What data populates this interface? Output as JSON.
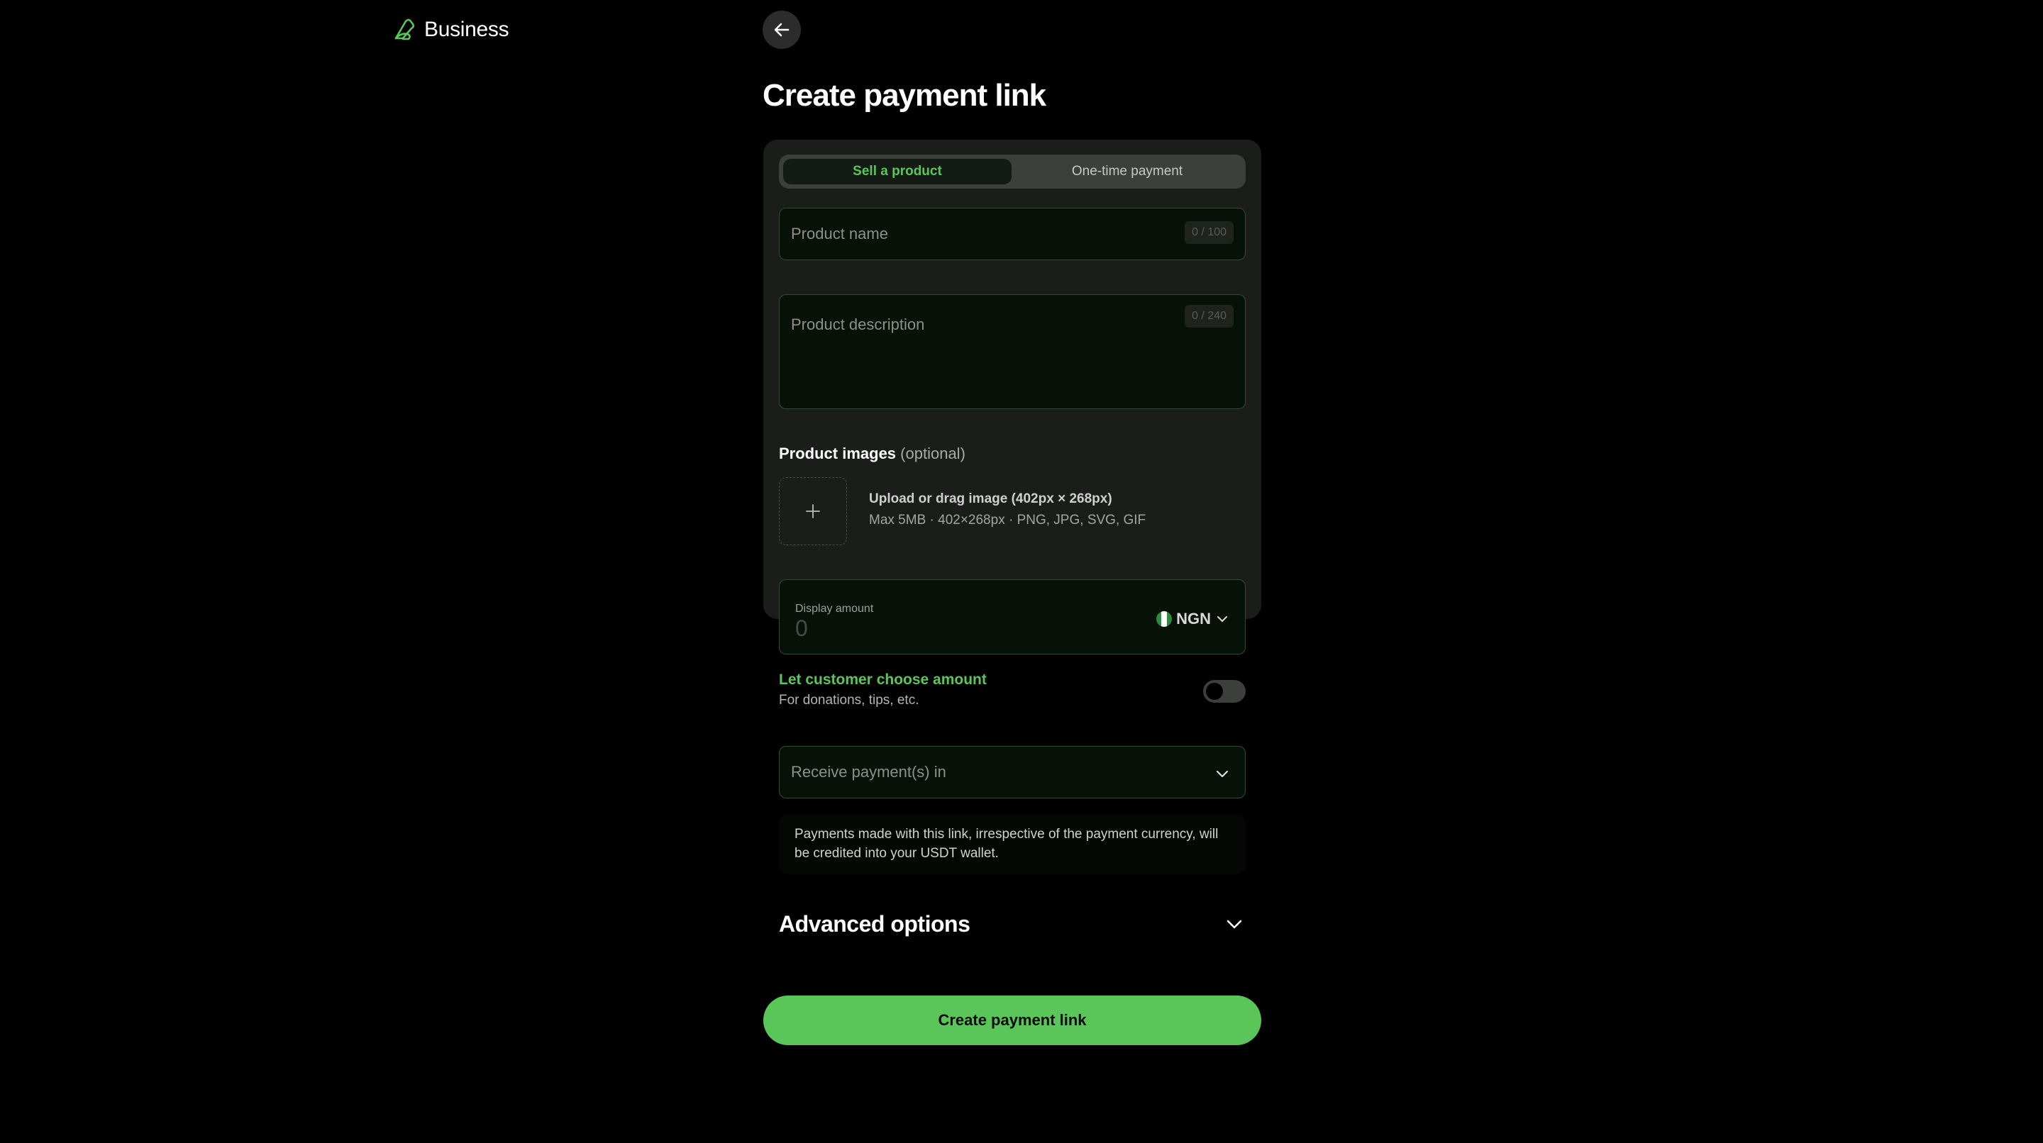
{
  "brand": {
    "name": "Business"
  },
  "page": {
    "title": "Create payment link"
  },
  "tabs": [
    {
      "label": "Sell a product",
      "active": true
    },
    {
      "label": "One-time payment",
      "active": false
    }
  ],
  "product_name": {
    "placeholder": "Product name",
    "counter": "0 / 100"
  },
  "product_description": {
    "placeholder": "Product description",
    "counter": "0 / 240"
  },
  "product_images": {
    "label": "Product images",
    "optional": "(optional)",
    "upload_title": "Upload or drag image (402px × 268px)",
    "upload_sub": "Max 5MB · 402×268px · PNG, JPG, SVG, GIF"
  },
  "amount": {
    "label": "Display amount",
    "value": "0",
    "currency": "NGN"
  },
  "choose_amount": {
    "title": "Let customer choose amount",
    "subtitle": "For donations, tips, etc.",
    "enabled": false
  },
  "receive": {
    "placeholder": "Receive payment(s) in"
  },
  "note": {
    "text": "Payments made with this link, irrespective of the payment currency, will be credited into your USDT wallet."
  },
  "advanced": {
    "label": "Advanced options"
  },
  "submit": {
    "label": "Create payment link"
  },
  "colors": {
    "accent": "#5ac65a",
    "background": "#000000",
    "card": "#1b1d1b",
    "field_bg": "#071107",
    "field_border": "#2f4d2f"
  },
  "icons": [
    "logo-icon",
    "arrow-left-icon",
    "plus-icon",
    "nigeria-flag-icon",
    "chevron-down-icon"
  ]
}
